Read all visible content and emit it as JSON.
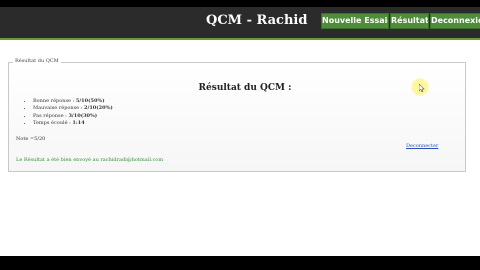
{
  "header": {
    "title": "QCM - Rachid",
    "nav": [
      {
        "label": "Nouvelle Essaie"
      },
      {
        "label": "Résultat"
      },
      {
        "label": "Deconnexion"
      }
    ]
  },
  "panel": {
    "legend": "Résultat du QCM",
    "title": "Résultat du QCM :",
    "stats": [
      {
        "label": "Bonne réponse :",
        "value": "5/10(50%)"
      },
      {
        "label": "Mauvaise réponse :",
        "value": "2/10(20%)"
      },
      {
        "label": "Pas réponse :",
        "value": "3/10(30%)"
      },
      {
        "label": "Temps écoulé :",
        "value": "1:14"
      }
    ],
    "note": "Note =5/20",
    "link": "Deconnecter",
    "email_note": "Le Résultat a été bien envoyé au rachidradi@hotmail.com"
  },
  "colors": {
    "header_bg": "#2b2b2b",
    "accent_green": "#4f8d3a",
    "link_blue": "#2d4fb4",
    "success_green": "#2f8f2f"
  }
}
